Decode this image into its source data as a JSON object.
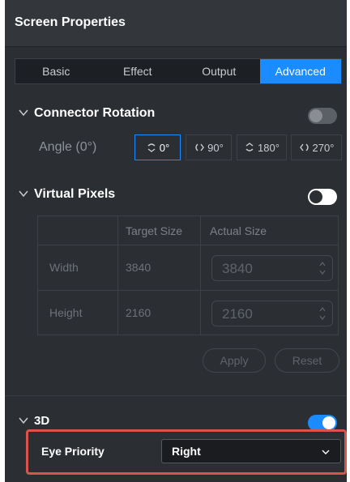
{
  "header": {
    "title": "Screen Properties"
  },
  "tabs": [
    {
      "label": "Basic"
    },
    {
      "label": "Effect"
    },
    {
      "label": "Output"
    },
    {
      "label": "Advanced"
    }
  ],
  "connector_rotation": {
    "title": "Connector Rotation",
    "angle_label": "Angle (0°)",
    "options": [
      {
        "label": "0°",
        "icon": "rotate-0-icon"
      },
      {
        "label": "90°",
        "icon": "rotate-90-icon"
      },
      {
        "label": "180°",
        "icon": "rotate-180-icon"
      },
      {
        "label": "270°",
        "icon": "rotate-270-icon"
      }
    ],
    "selected": "0°",
    "toggle_on": false
  },
  "virtual_pixels": {
    "title": "Virtual Pixels",
    "toggle_on": false,
    "columns": [
      "Target Size",
      "Actual Size"
    ],
    "rows": [
      {
        "label": "Width",
        "target": "3840",
        "actual": "3840"
      },
      {
        "label": "Height",
        "target": "2160",
        "actual": "2160"
      }
    ],
    "apply_label": "Apply",
    "reset_label": "Reset"
  },
  "three_d": {
    "title": "3D",
    "toggle_on": true,
    "eye_priority_label": "Eye Priority",
    "eye_priority_value": "Right"
  },
  "colors": {
    "accent": "#1a8cff",
    "panel_bg": "#2b2e33",
    "highlight_border": "#d9534f"
  }
}
